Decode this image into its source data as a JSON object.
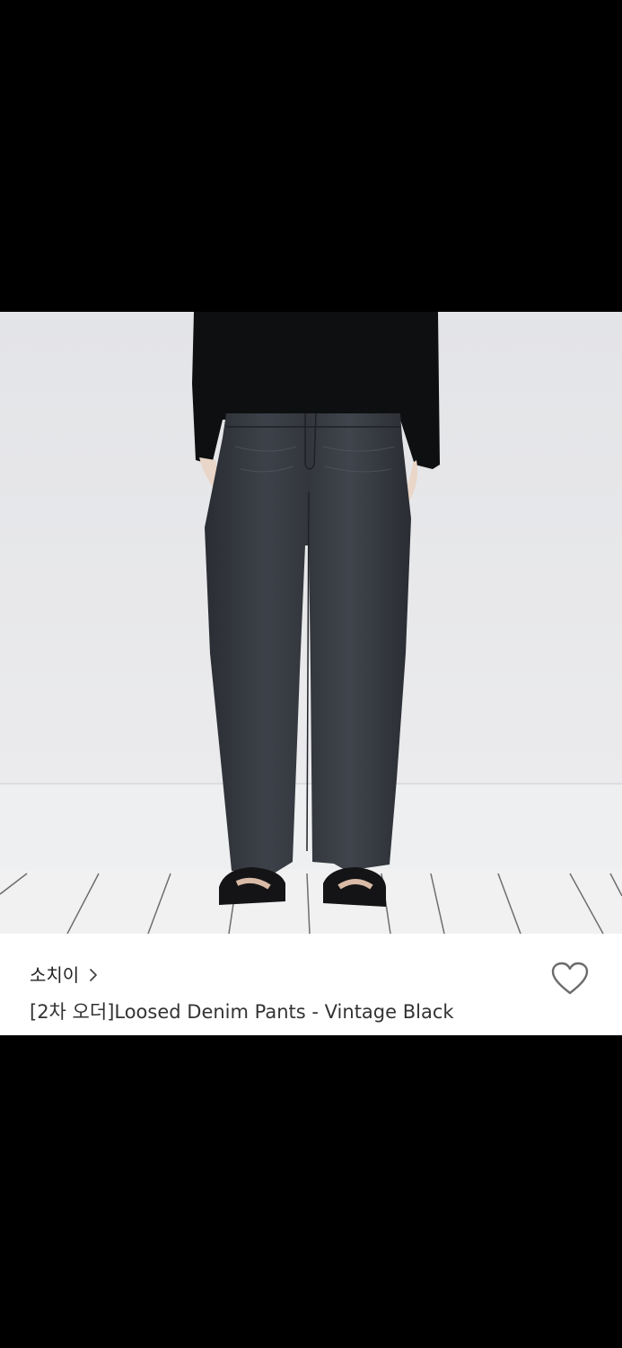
{
  "product": {
    "image_alt": "Loosed Denim Pants - Vintage Black",
    "brand": {
      "name": "소치이",
      "chevron_icon": "chevron-right-icon"
    },
    "title": "[2차 오더]Loosed Denim Pants - Vintage Black",
    "wishlist": {
      "icon": "heart-outline-icon",
      "active": false
    }
  },
  "colors": {
    "background": "#000000",
    "panel": "#ffffff",
    "brand_text": "#222222",
    "title_text": "#333333",
    "heart_stroke": "#6b6b6b"
  }
}
